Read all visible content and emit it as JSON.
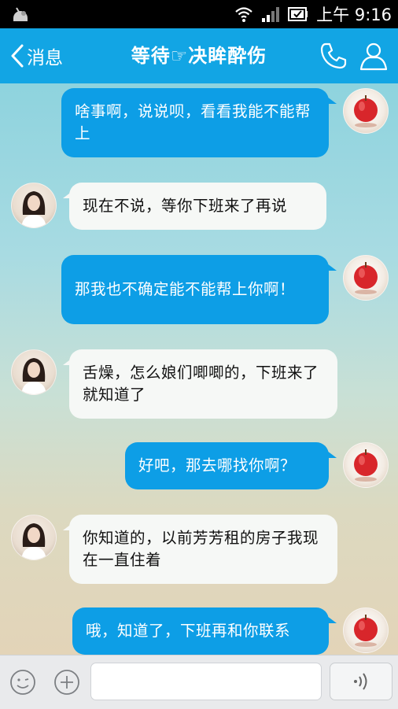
{
  "status_bar": {
    "time": "上午 9:16"
  },
  "header": {
    "back_label": "消息",
    "title": "等待☞决眸酔伤"
  },
  "messages": [
    {
      "from": "me",
      "text": "啥事啊，说说呗，看看我能不能帮上"
    },
    {
      "from": "other",
      "text": "现在不说，等你下班来了再说"
    },
    {
      "from": "me",
      "text": "那我也不确定能不能帮上你啊！"
    },
    {
      "from": "other",
      "text": "舌燥，怎么娘们唧唧的，下班来了就知道了"
    },
    {
      "from": "me",
      "text": "好吧，那去哪找你啊？"
    },
    {
      "from": "other",
      "text": "你知道的，以前芳芳租的房子我现在一直住着"
    },
    {
      "from": "me",
      "text": "哦，知道了，下班再和你联系"
    }
  ],
  "input": {
    "value": "",
    "placeholder": ""
  },
  "colors": {
    "header_bg": "#12a5e4",
    "outgoing_bubble": "#0d9ee6",
    "incoming_bubble": "#f6f8f6"
  }
}
